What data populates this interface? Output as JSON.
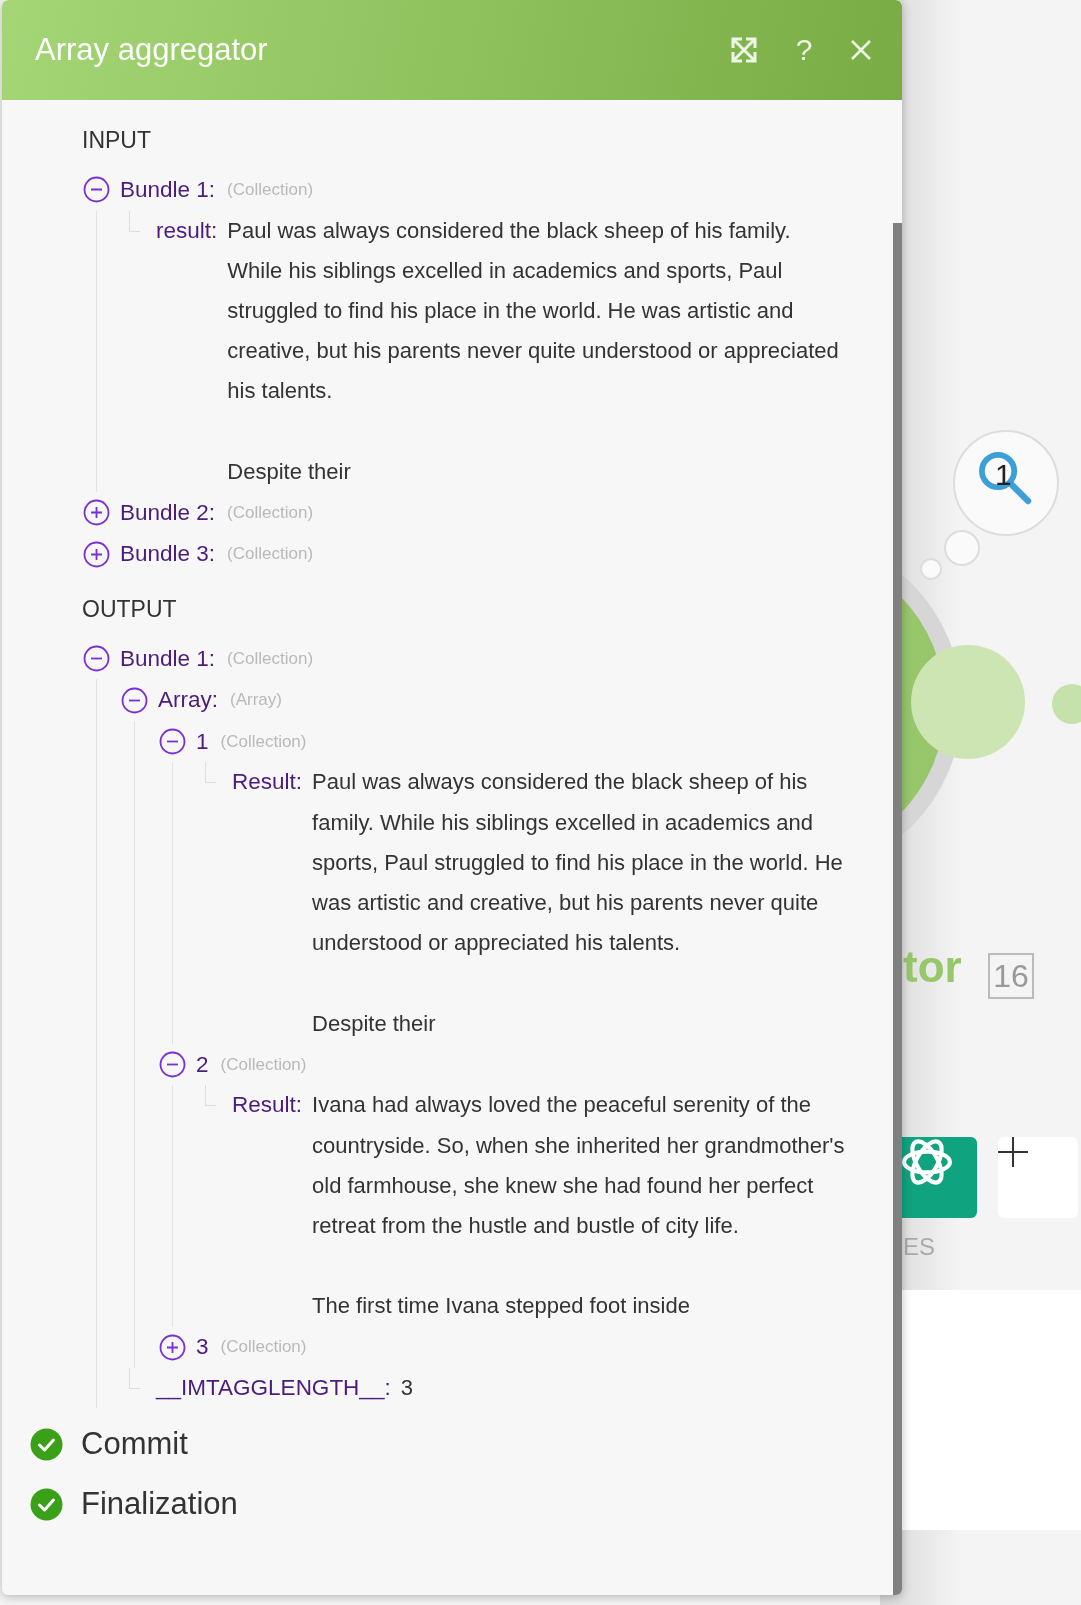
{
  "dialog": {
    "title": "Array aggregator",
    "help_label": "?"
  },
  "sections": [
    {
      "title": "INPUT",
      "items": [
        {
          "kind": "node",
          "label": "Bundle 1:",
          "type": "(Collection)",
          "expanded": true,
          "children": [
            {
              "kind": "field",
              "label": "result:",
              "value": "Paul was always considered the black sheep of his family. While his siblings excelled in academics and sports, Paul struggled to find his place in the world. He was artistic and creative, but his parents never quite understood or appreciated his talents.\n\nDespite their"
            }
          ]
        },
        {
          "kind": "node",
          "label": "Bundle 2:",
          "type": "(Collection)",
          "expanded": false
        },
        {
          "kind": "node",
          "label": "Bundle 3:",
          "type": "(Collection)",
          "expanded": false
        }
      ]
    },
    {
      "title": "OUTPUT",
      "items": [
        {
          "kind": "node",
          "label": "Bundle 1:",
          "type": "(Collection)",
          "expanded": true,
          "children": [
            {
              "kind": "node",
              "label": "Array:",
              "type": "(Array)",
              "expanded": true,
              "children": [
                {
                  "kind": "node",
                  "label": "1",
                  "type": "(Collection)",
                  "expanded": true,
                  "children": [
                    {
                      "kind": "field",
                      "label": "Result:",
                      "value": "Paul was always considered the black sheep of his family. While his siblings excelled in academics and sports, Paul struggled to find his place in the world. He was artistic and creative, but his parents never quite understood or appreciated his talents.\n\nDespite their"
                    }
                  ]
                },
                {
                  "kind": "node",
                  "label": "2",
                  "type": "(Collection)",
                  "expanded": true,
                  "children": [
                    {
                      "kind": "field",
                      "label": "Result:",
                      "value": "Ivana had always loved the peaceful serenity of the countryside. So, when she inherited her grandmother's old farmhouse, she knew she had found her perfect retreat from the hustle and bustle of city life.\n\nThe first time Ivana stepped foot inside"
                    }
                  ]
                },
                {
                  "kind": "node",
                  "label": "3",
                  "type": "(Collection)",
                  "expanded": false
                }
              ]
            },
            {
              "kind": "field",
              "label": "__IMTAGGLENGTH__:",
              "value": "3"
            }
          ]
        }
      ]
    }
  ],
  "statuses": [
    {
      "label": "Commit",
      "done": true
    },
    {
      "label": "Finalization",
      "done": true
    }
  ],
  "canvas": {
    "search_bubble": "1",
    "module_name": "tor",
    "badge": "16",
    "caption": "ES"
  }
}
